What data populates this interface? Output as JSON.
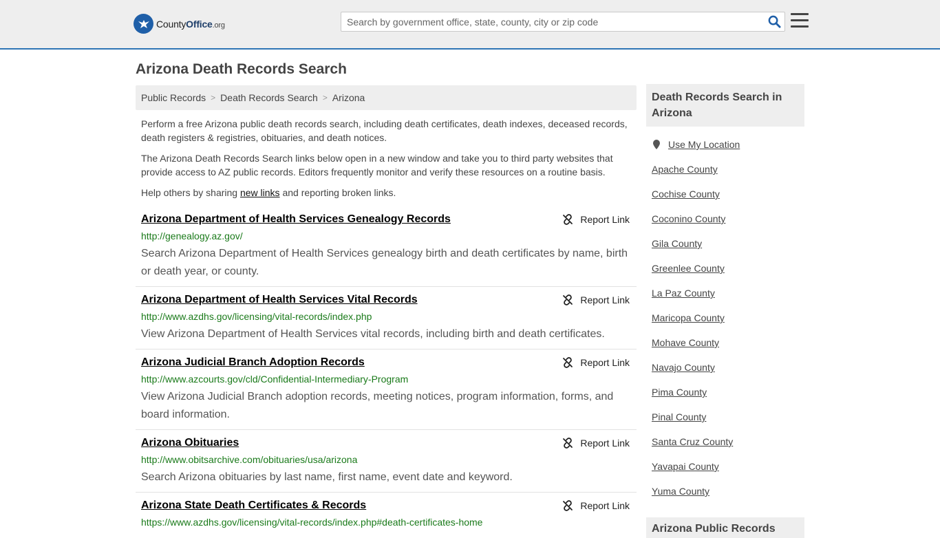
{
  "header": {
    "logo_main": "County",
    "logo_bold": "Office",
    "logo_suffix": ".org",
    "search_placeholder": "Search by government office, state, county, city or zip code",
    "accent_color": "#2e74b5"
  },
  "page": {
    "title": "Arizona Death Records Search"
  },
  "breadcrumb": {
    "items": [
      "Public Records",
      "Death Records Search",
      "Arizona"
    ],
    "separator": ">"
  },
  "intro": {
    "p1": "Perform a free Arizona public death records search, including death certificates, death indexes, deceased records, death registers & registries, obituaries, and death notices.",
    "p2": "The Arizona Death Records Search links below open in a new window and take you to third party websites that provide access to AZ public records. Editors frequently monitor and verify these resources on a routine basis.",
    "p3_before": "Help others by sharing ",
    "p3_link": "new links",
    "p3_after": " and reporting broken links."
  },
  "report_label": "Report Link",
  "results": [
    {
      "title": "Arizona Department of Health Services Genealogy Records",
      "url": "http://genealogy.az.gov/",
      "desc": "Search Arizona Department of Health Services genealogy birth and death certificates by name, birth or death year, or county."
    },
    {
      "title": "Arizona Department of Health Services Vital Records",
      "url": "http://www.azdhs.gov/licensing/vital-records/index.php",
      "desc": "View Arizona Department of Health Services vital records, including birth and death certificates."
    },
    {
      "title": "Arizona Judicial Branch Adoption Records",
      "url": "http://www.azcourts.gov/cld/Confidential-Intermediary-Program",
      "desc": "View Arizona Judicial Branch adoption records, meeting notices, program information, forms, and board information."
    },
    {
      "title": "Arizona Obituaries",
      "url": "http://www.obitsarchive.com/obituaries/usa/arizona",
      "desc": "Search Arizona obituaries by last name, first name, event date and keyword."
    },
    {
      "title": "Arizona State Death Certificates & Records",
      "url": "https://www.azdhs.gov/licensing/vital-records/index.php#death-certificates-home",
      "desc": ""
    }
  ],
  "sidebar": {
    "title": "Death Records Search in Arizona",
    "use_location": "Use My Location",
    "counties": [
      "Apache County",
      "Cochise County",
      "Coconino County",
      "Gila County",
      "Greenlee County",
      "La Paz County",
      "Maricopa County",
      "Mohave County",
      "Navajo County",
      "Pima County",
      "Pinal County",
      "Santa Cruz County",
      "Yavapai County",
      "Yuma County"
    ],
    "title2": "Arizona Public Records"
  }
}
